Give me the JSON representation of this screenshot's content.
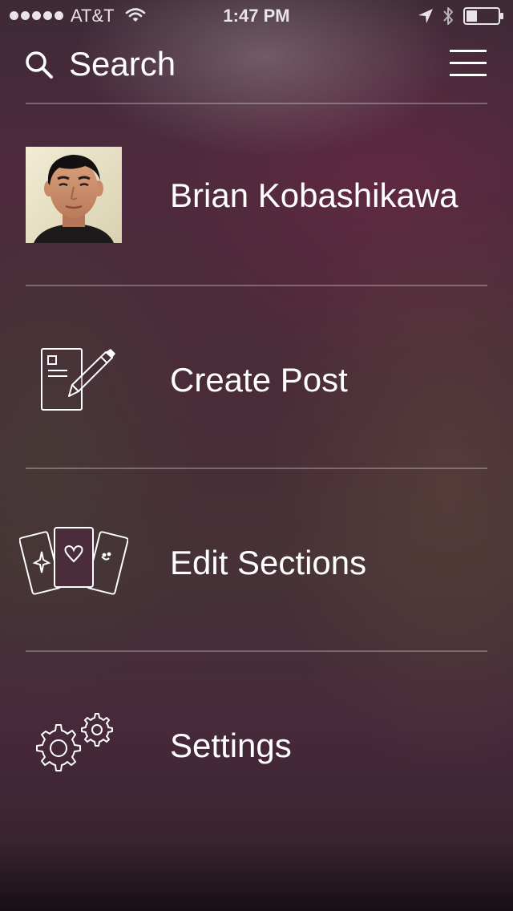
{
  "status_bar": {
    "carrier": "AT&T",
    "time": "1:47 PM",
    "signal_bars": 5,
    "battery_level": 0.35
  },
  "header": {
    "search_label": "Search",
    "search_icon": "search-icon",
    "menu_icon": "hamburger-menu-icon"
  },
  "profile": {
    "name": "Brian Kobashikawa",
    "avatar": "avatar"
  },
  "menu": {
    "create_post": {
      "label": "Create Post",
      "icon": "create-post-icon"
    },
    "edit_sections": {
      "label": "Edit Sections",
      "icon": "edit-sections-icon"
    },
    "settings": {
      "label": "Settings",
      "icon": "settings-gear-icon"
    }
  },
  "colors": {
    "text": "#ffffff",
    "background_top": "#4d2a3c",
    "background_bottom": "#161014",
    "divider": "rgba(255,255,255,0.28)",
    "avatar_bg": "#e9e2c6"
  }
}
